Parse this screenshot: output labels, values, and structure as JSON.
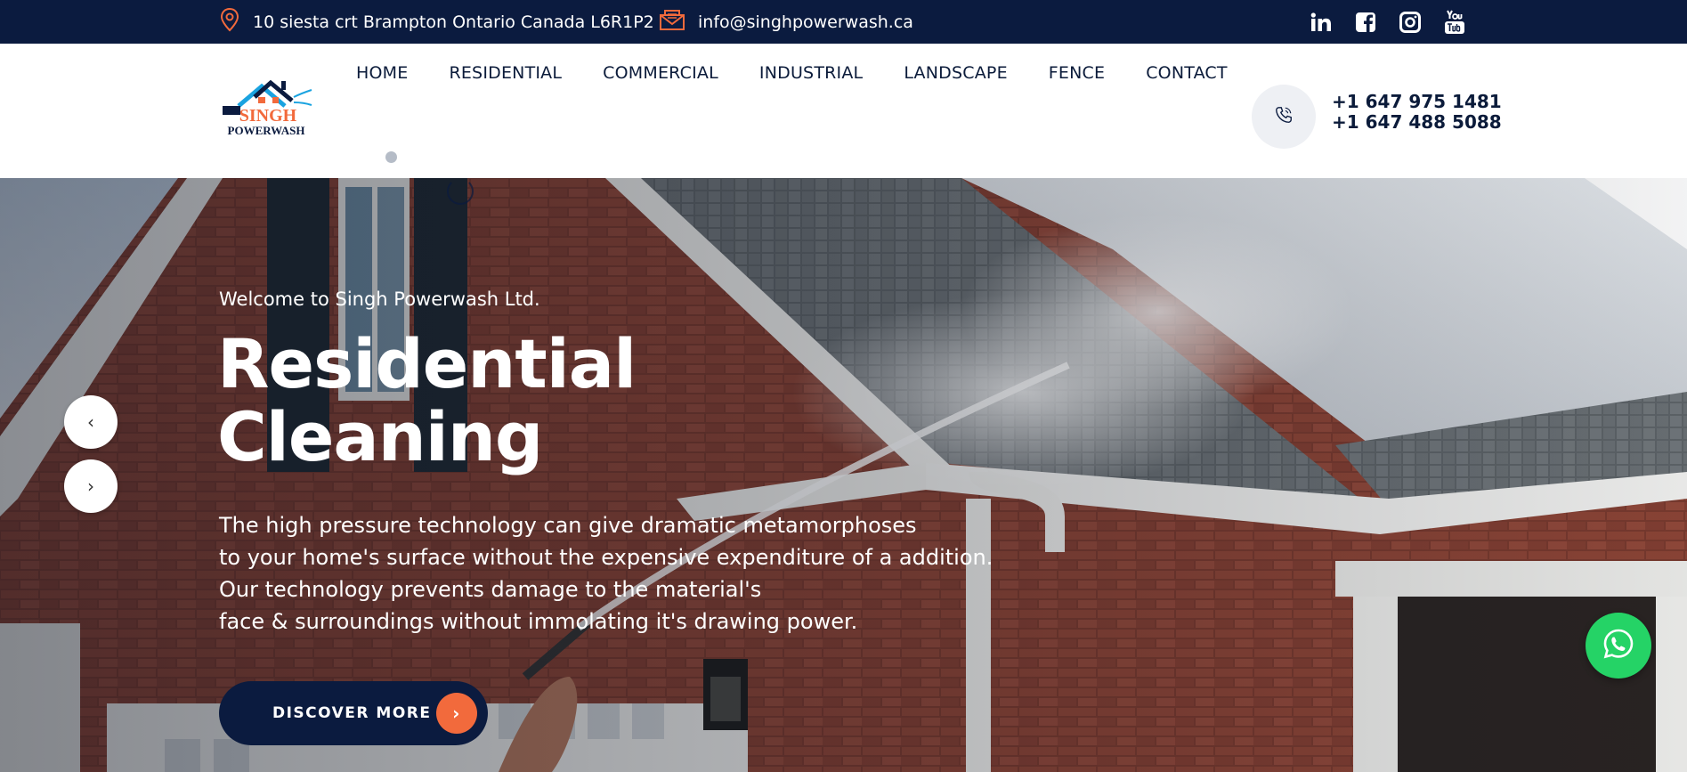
{
  "topbar": {
    "address": "10 siesta crt Brampton Ontario Canada L6R1P2",
    "email": "info@singhpowerwash.ca",
    "social": [
      "linkedin-icon",
      "facebook-icon",
      "instagram-icon",
      "youtube-icon"
    ]
  },
  "logo": {
    "line1": "SINGH",
    "line2": "POWERWASH"
  },
  "nav": {
    "items": [
      "HOME",
      "RESIDENTIAL",
      "COMMERCIAL",
      "INDUSTRIAL",
      "LANDSCAPE",
      "FENCE",
      "CONTACT"
    ]
  },
  "contact": {
    "phone1": "+1 647 975 1481",
    "phone2": "+1 647 488 5088"
  },
  "hero": {
    "welcome": "Welcome to Singh Powerwash Ltd.",
    "title_line1": "Residential",
    "title_line2": "Cleaning",
    "text": [
      "The high pressure technology can give dramatic metamorphoses",
      "to your home's surface without the expensive expenditure of a addition.",
      "Our technology prevents damage to the material's",
      "face & surroundings without immolating it's drawing power."
    ],
    "button": "DISCOVER MORE",
    "prev": "‹",
    "next": "›"
  },
  "colors": {
    "navy": "#0b1b3f",
    "accent": "#f26a3c",
    "whatsapp": "#25d366"
  }
}
